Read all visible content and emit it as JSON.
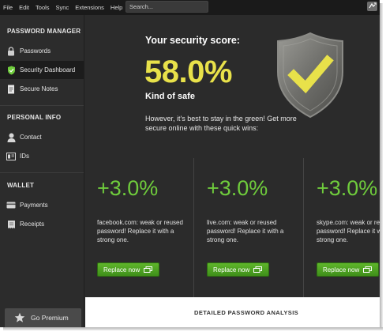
{
  "menubar": {
    "items": [
      "File",
      "Edit",
      "Tools",
      "Sync",
      "Extensions",
      "Help"
    ],
    "search_placeholder": "Search..."
  },
  "sidebar": {
    "sections": {
      "password_manager": "PASSWORD MANAGER",
      "personal_info": "PERSONAL INFO",
      "wallet": "WALLET"
    },
    "items": [
      {
        "label": "Passwords",
        "icon": "lock-icon"
      },
      {
        "label": "Security Dashboard",
        "icon": "shield-icon",
        "active": true
      },
      {
        "label": "Secure Notes",
        "icon": "note-icon"
      },
      {
        "label": "Contact",
        "icon": "person-icon"
      },
      {
        "label": "IDs",
        "icon": "id-card-icon"
      },
      {
        "label": "Payments",
        "icon": "credit-card-icon"
      },
      {
        "label": "Receipts",
        "icon": "receipt-icon"
      }
    ],
    "premium_label": "Go Premium"
  },
  "dashboard": {
    "score_title": "Your security score:",
    "score_value": "58.0%",
    "score_rating": "Kind of safe",
    "description": "However, it's best to stay in the green! Get more secure online with these quick wins:",
    "accent_color": "#e8e14a",
    "gain_color": "#6fcc3c"
  },
  "quick_wins": [
    {
      "gain": "+3.0%",
      "message": "facebook.com: weak or reused password! Replace it with a strong one.",
      "button": "Replace now"
    },
    {
      "gain": "+3.0%",
      "message": "live.com: weak or reused password! Replace it with a strong one.",
      "button": "Replace now"
    },
    {
      "gain": "+3.0%",
      "message": "skype.com: weak or reused password! Replace it with a strong one.",
      "button": "Replace now"
    }
  ],
  "analysis": {
    "label": "DETAILED PASSWORD ANALYSIS"
  }
}
